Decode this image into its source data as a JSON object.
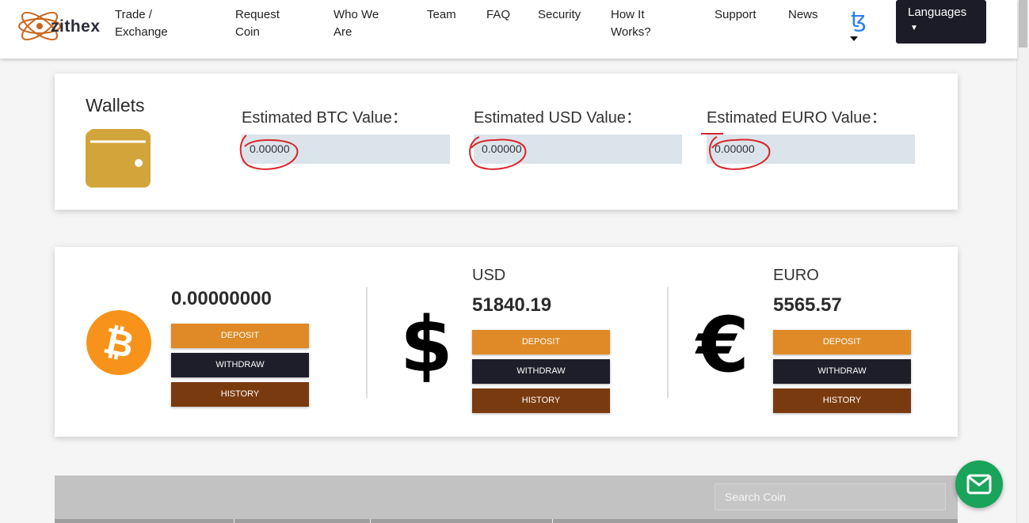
{
  "logo": {
    "brand": "zithex"
  },
  "nav": {
    "items": [
      {
        "label": "Trade / Exchange"
      },
      {
        "label": "Request Coin"
      },
      {
        "label": "Who We Are"
      },
      {
        "label": "Team"
      },
      {
        "label": "FAQ"
      },
      {
        "label": "Security"
      },
      {
        "label": "How It Works?"
      },
      {
        "label": "Support"
      },
      {
        "label": "News"
      }
    ],
    "tezos_icon": "tezos-icon",
    "languages_label": "Languages"
  },
  "wallets": {
    "title": "Wallets",
    "icon": "wallet-icon",
    "estimates": [
      {
        "label": "Estimated BTC Value：",
        "value": "0.00000"
      },
      {
        "label": "Estimated USD Value：",
        "value": "0.00000"
      },
      {
        "label": "Estimated EURO Value：",
        "value": "0.00000"
      }
    ]
  },
  "balances": {
    "btc": {
      "icon": "bitcoin-icon",
      "amount": "0.00000000"
    },
    "usd": {
      "name": "USD",
      "icon": "dollar-icon",
      "amount": "51840.19"
    },
    "euro": {
      "name": "EURO",
      "icon": "euro-icon",
      "amount": "5565.57"
    },
    "buttons": {
      "deposit": "DEPOSIT",
      "withdraw": "WITHDRAW",
      "history": "HISTORY"
    }
  },
  "table": {
    "search_placeholder": "Search Coin"
  },
  "colors": {
    "deposit": "#df8a26",
    "withdraw": "#1e1e2a",
    "history": "#7a3a10",
    "chat": "#1aa35a",
    "annotation": "#d9252a"
  }
}
